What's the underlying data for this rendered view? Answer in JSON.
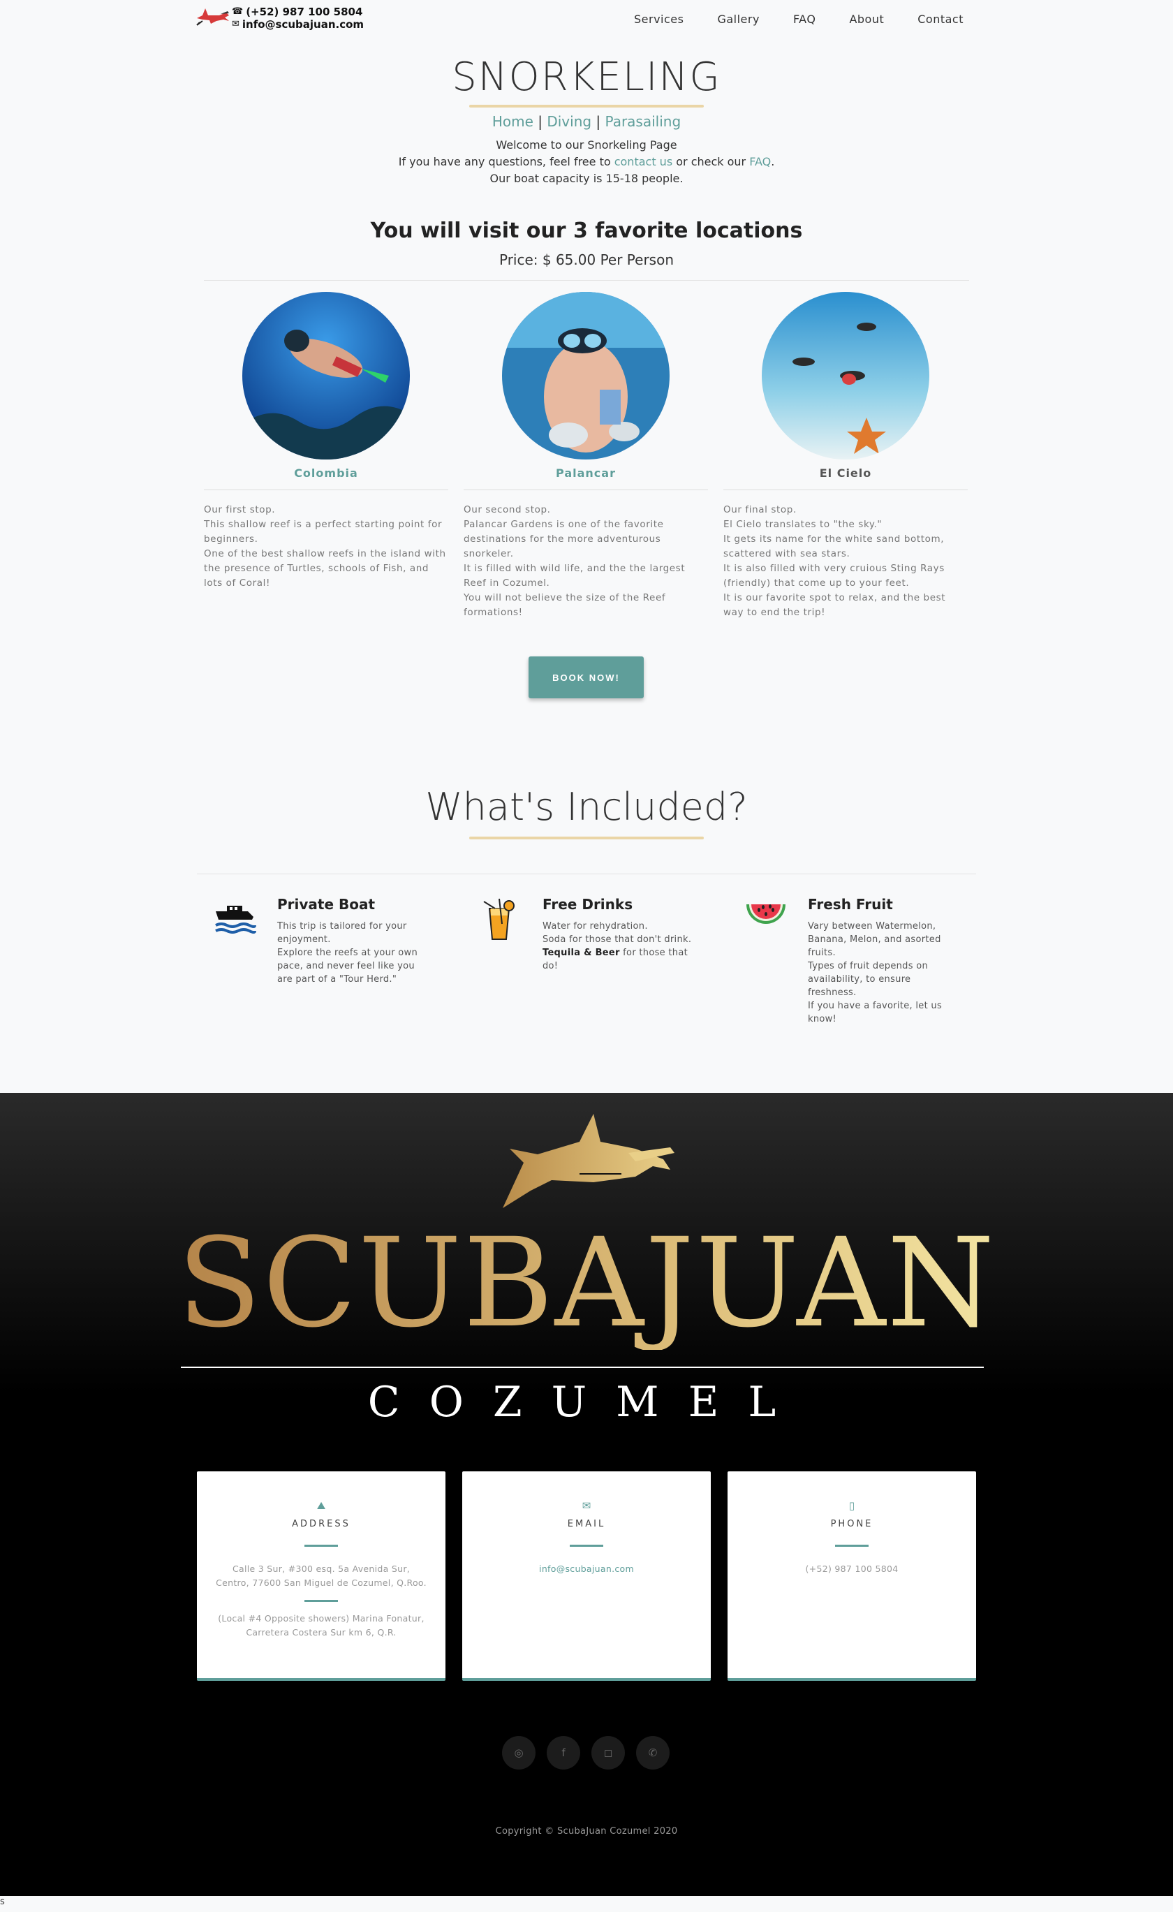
{
  "header": {
    "phone": "(+52) 987 100 5804",
    "email": "info@scubajuan.com",
    "nav": [
      "Services",
      "Gallery",
      "FAQ",
      "About",
      "Contact"
    ]
  },
  "hero": {
    "title": "SNORKELING",
    "crumbs": [
      "Home",
      "Diving",
      "Parasailing"
    ],
    "welcome": "Welcome to our Snorkeling Page",
    "q_prefix": "If you have any questions, feel free to ",
    "contact_link": "contact us",
    "q_mid": " or check our ",
    "faq_link": "FAQ",
    "q_suffix": ".",
    "capacity": "Our boat capacity is 15-18 people."
  },
  "visit": {
    "title": "You will visit our 3 favorite locations",
    "price": "Price: $ 65.00 Per Person"
  },
  "locations": [
    {
      "name": "Colombia",
      "name_color": "#5f9e9a",
      "lines": [
        "Our first stop.",
        "This shallow reef is a perfect starting point for beginners.",
        "One of the best shallow reefs in the island with the presence of Turtles, schools of Fish, and lots of Coral!"
      ]
    },
    {
      "name": "Palancar",
      "name_color": "#5f9e9a",
      "lines": [
        "Our second stop.",
        "Palancar Gardens is one of the favorite destinations for the more adventurous snorkeler.",
        "It is filled with wild life, and the the largest Reef in Cozumel.",
        "You will not believe the size of the Reef formations!"
      ]
    },
    {
      "name": "El Cielo",
      "name_color": "#555555",
      "lines": [
        "Our final stop.",
        "El Cielo translates to \"the sky.\"",
        "It gets its name for the white sand bottom, scattered with sea stars.",
        "It is also filled with very cruious Sting Rays (friendly) that come up to your feet.",
        "It is our favorite spot to relax, and the best way to end the trip!"
      ]
    }
  ],
  "book_button": "BOOK NOW!",
  "included": {
    "title": "What's Included?",
    "items": [
      {
        "title": "Private Boat",
        "icon": "boat-icon",
        "lines": [
          "This trip is tailored for your enjoyment.",
          "Explore the reefs at your own pace, and never feel like you are part of a \"Tour Herd.\""
        ]
      },
      {
        "title": "Free Drinks",
        "icon": "drink-icon",
        "line1": "Water for rehydration.",
        "line2": "Soda for those that don't drink.",
        "bold": "Tequila & Beer",
        "line3": " for those that do!"
      },
      {
        "title": "Fresh Fruit",
        "icon": "watermelon-icon",
        "lines": [
          "Vary between Watermelon, Banana, Melon, and asorted fruits.",
          "Types of fruit depends on availability, to ensure freshness.",
          "If you have a favorite, let us know!"
        ]
      }
    ]
  },
  "footer": {
    "logo_word": "SCUBAJUAN",
    "logo_sub": "COZUMEL",
    "cards": {
      "address": {
        "label": "ADDRESS",
        "line1": "Calle 3 Sur, #300 esq. 5a Avenida Sur, Centro, 77600 San Miguel de Cozumel, Q.Roo.",
        "line2": "(Local #4 Opposite showers) Marina Fonatur, Carretera Costera Sur km 6, Q.R."
      },
      "email": {
        "label": "EMAIL",
        "value": "info@scubajuan.com"
      },
      "phone": {
        "label": "PHONE",
        "value": "(+52) 987 100 5804"
      }
    },
    "social": [
      "tripadvisor-icon",
      "facebook-icon",
      "instagram-icon",
      "whatsapp-icon"
    ],
    "copyright": "Copyright © ScubaJuan Cozumel 2020"
  },
  "stray_char": "s",
  "colors": {
    "accent": "#5f9e9a",
    "gold": "#ead5a6",
    "footer_bg": "#000000"
  }
}
